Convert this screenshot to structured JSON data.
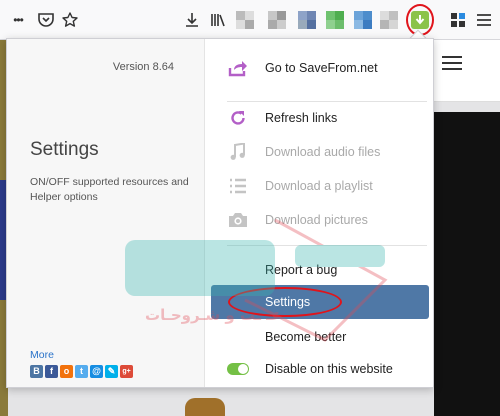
{
  "toolbar": {
    "icons": [
      "more-icon",
      "pocket-icon",
      "bookmark-star-icon",
      "download-icon",
      "library-icon",
      "savefrom-extension-icon",
      "extensions-icon",
      "menu-icon"
    ],
    "overflow_glyph": "•••"
  },
  "panel": {
    "version": "Version 8.64",
    "settings_title": "Settings",
    "settings_description": "ON/OFF supported resources and Helper options",
    "more_link": "More",
    "socials": [
      {
        "name": "vk",
        "glyph": "B",
        "color": "#4c75a3"
      },
      {
        "name": "facebook",
        "glyph": "f",
        "color": "#3b5998"
      },
      {
        "name": "odnoklassniki",
        "glyph": "o",
        "color": "#f2720c"
      },
      {
        "name": "twitter",
        "glyph": "t",
        "color": "#55acee"
      },
      {
        "name": "mail",
        "glyph": "@",
        "color": "#168de2"
      },
      {
        "name": "livejournal",
        "glyph": "✎",
        "color": "#00b0ea"
      },
      {
        "name": "google-plus",
        "glyph": "g+",
        "color": "#dd4b39"
      }
    ],
    "menu": {
      "goto": "Go to SaveFrom.net",
      "refresh": "Refresh links",
      "audio": "Download audio files",
      "playlist": "Download a playlist",
      "pictures": "Download pictures",
      "report": "Report a bug",
      "settings": "Settings",
      "better": "Become better",
      "disable": "Disable on this website"
    }
  },
  "colors": {
    "accent_purple": "#b35fc7",
    "active_item": "#4f78a6",
    "toggle_on": "#74c045",
    "annotation_red": "#e0141b"
  }
}
